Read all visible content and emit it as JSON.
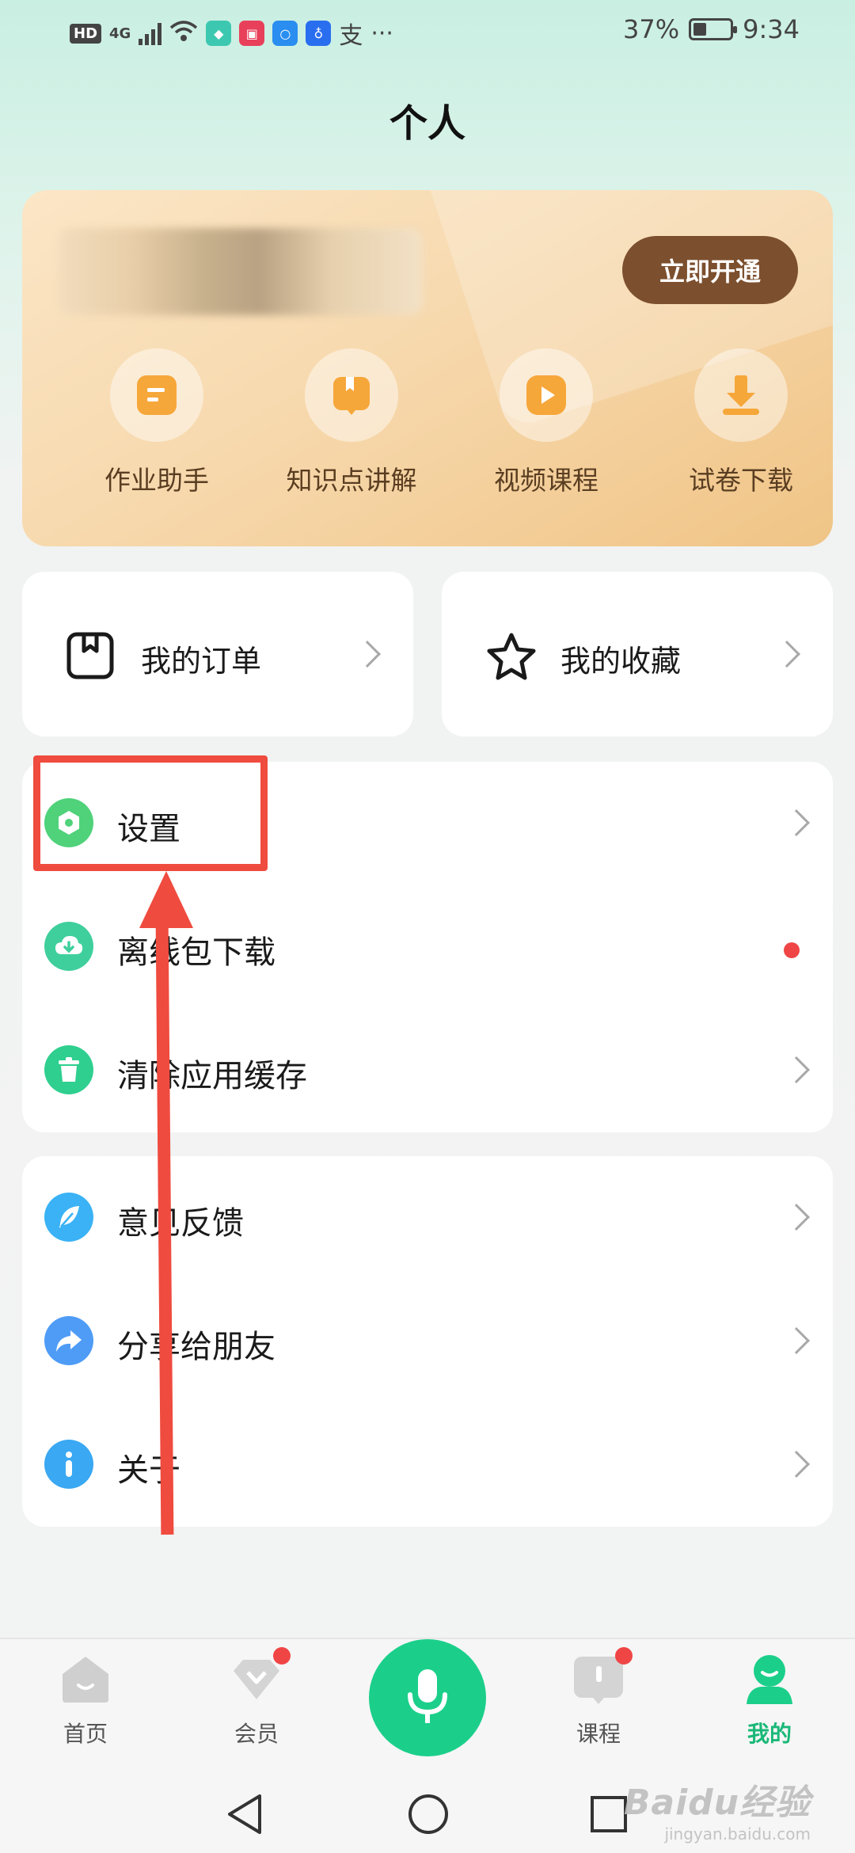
{
  "status_bar": {
    "hd": "HD",
    "network": "4G",
    "ime": "支",
    "more": "···",
    "battery": "37%",
    "time": "9:34"
  },
  "header": {
    "title": "个人"
  },
  "vip_card": {
    "open_button": "立即开通",
    "features": [
      {
        "label": "作业助手",
        "icon": "homework-icon"
      },
      {
        "label": "知识点讲解",
        "icon": "book-icon"
      },
      {
        "label": "视频课程",
        "icon": "play-icon"
      },
      {
        "label": "试卷下载",
        "icon": "download-icon"
      }
    ]
  },
  "quick": {
    "orders": "我的订单",
    "favorites": "我的收藏"
  },
  "menu_group_1": [
    {
      "label": "设置",
      "icon": "settings-icon",
      "color": "#4fd27a"
    },
    {
      "label": "离线包下载",
      "icon": "cloud-download-icon",
      "color": "#3fcf9c"
    },
    {
      "label": "清除应用缓存",
      "icon": "trash-icon",
      "color": "#2fcf8f"
    }
  ],
  "menu_group_2": [
    {
      "label": "意见反馈",
      "icon": "feather-icon",
      "color": "#3ab2f5"
    },
    {
      "label": "分享给朋友",
      "icon": "share-icon",
      "color": "#4f9cf7"
    },
    {
      "label": "关于",
      "icon": "info-icon",
      "color": "#3aa8f2"
    }
  ],
  "tabs": [
    {
      "label": "首页",
      "icon": "home-icon"
    },
    {
      "label": "会员",
      "icon": "vip-diamond-icon"
    },
    {
      "label": "课程",
      "icon": "course-icon"
    },
    {
      "label": "我的",
      "icon": "profile-icon"
    }
  ],
  "colors": {
    "accent_green": "#1bcf8a",
    "annotation_red": "#ef4b3f",
    "vip_brown": "#7c4f2e"
  },
  "watermark": {
    "main": "Baidu经验",
    "sub": "jingyan.baidu.com"
  }
}
